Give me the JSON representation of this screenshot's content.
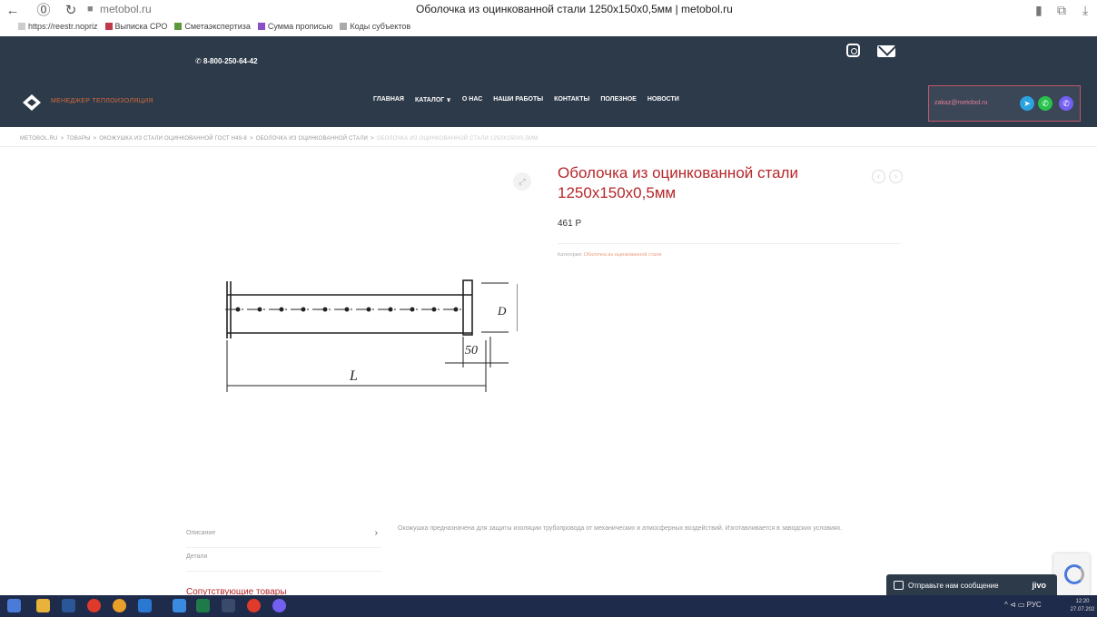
{
  "browser": {
    "back": "←",
    "sidebar": "⓪",
    "reload": "↻",
    "lock": "■",
    "url": "metobol.ru",
    "tab_title": "Оболочка из оцинкованной стали 1250x150x0,5мм | metobol.ru",
    "bookmark_icon": "▮",
    "reader_icon": "⧉",
    "download_icon": "⤓",
    "bookmarks": [
      {
        "label": "https://reestr.nopriz",
        "color": "#cccccc"
      },
      {
        "label": "Выписка СРО",
        "color": "#c0394b"
      },
      {
        "label": "Сметаэкспертиза",
        "color": "#5a9a3a"
      },
      {
        "label": "Сумма прописью",
        "color": "#8a4fc8"
      },
      {
        "label": "Коды субъектов",
        "color": "#aaaaaa"
      }
    ]
  },
  "header": {
    "phone": "8-800-250-64-42",
    "logo_text": "МЕНЕДЖЕР ТЕПЛОИЗОЛЯЦИЯ",
    "menu": [
      "ГЛАВНАЯ",
      "КАТАЛОГ ∨",
      "О НАС",
      "НАШИ РАБОТЫ",
      "КОНТАКТЫ",
      "ПОЛЕЗНОЕ",
      "НОВОСТИ"
    ],
    "email": "zakaz@metobol.ru"
  },
  "breadcrumb": [
    "METOBOL.RU",
    "ТОВАРЫ",
    "ОКОЖУШКА ИЗ СТАЛИ ОЦИНКОВАННОЙ ГОСТ Н49-8",
    "ОБОЛОЧКА ИЗ ОЦИНКОВАННОЙ СТАЛИ",
    "ОБОЛОЧКА ИЗ ОЦИНКОВАННОЙ СТАЛИ 1250X150X0,5ММ"
  ],
  "product": {
    "title": "Оболочка из оцинкованной стали 1250x150x0,5мм",
    "price": "461 Р",
    "category_label": "Категория:",
    "category_value": "Оболочка из оцинкованной стали",
    "prev": "‹",
    "next": "›",
    "expand": "⤢",
    "drawing_labels": {
      "d": "D",
      "offset": "50",
      "length": "L"
    }
  },
  "tabs": [
    {
      "label": "Описание",
      "chevron": "›"
    },
    {
      "label": "Детали",
      "chevron": ""
    }
  ],
  "description": "Окожушка предназначена для защиты изоляции трубопровода от механических и атмосферных воздействий. Изготавливается в заводских условиях.",
  "related_title": "Сопутствующие товары",
  "chat": {
    "text": "Отправьте нам сообщение",
    "brand": "jivo"
  },
  "taskbar": {
    "tray": "^ ⊲ ▭ РУС",
    "time": "12:20",
    "date": "27.07.202"
  },
  "colors": {
    "dark": "#2d3a4a",
    "accent": "#b5262a"
  }
}
